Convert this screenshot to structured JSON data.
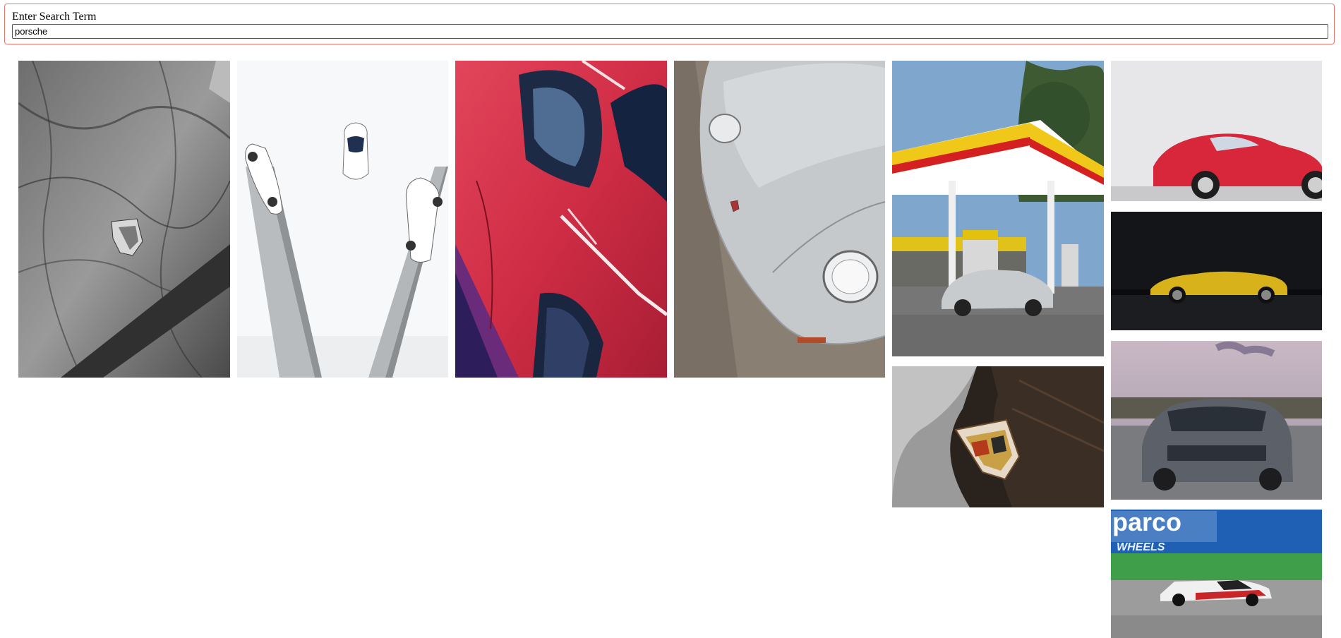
{
  "search": {
    "label": "Enter Search Term",
    "value": "porsche"
  },
  "results": [
    {
      "subject": "porsche-crest-on-bw-hood"
    },
    {
      "subject": "porsche-sculpture-three-cars"
    },
    {
      "subject": "red-classic-porsche-closeup"
    },
    {
      "subject": "silver-porsche-928-headlights"
    },
    {
      "subject": "silver-porsche-928-shell-station"
    },
    {
      "subject": "porsche-crest-closeup"
    },
    {
      "subject": "red-porsche-911-side"
    },
    {
      "subject": "yellow-porsche-convertible"
    },
    {
      "subject": "grey-porsche-cayenne"
    },
    {
      "subject": "porsche-919-race-car",
      "signage": [
        "parco",
        "WHEELS"
      ]
    }
  ]
}
